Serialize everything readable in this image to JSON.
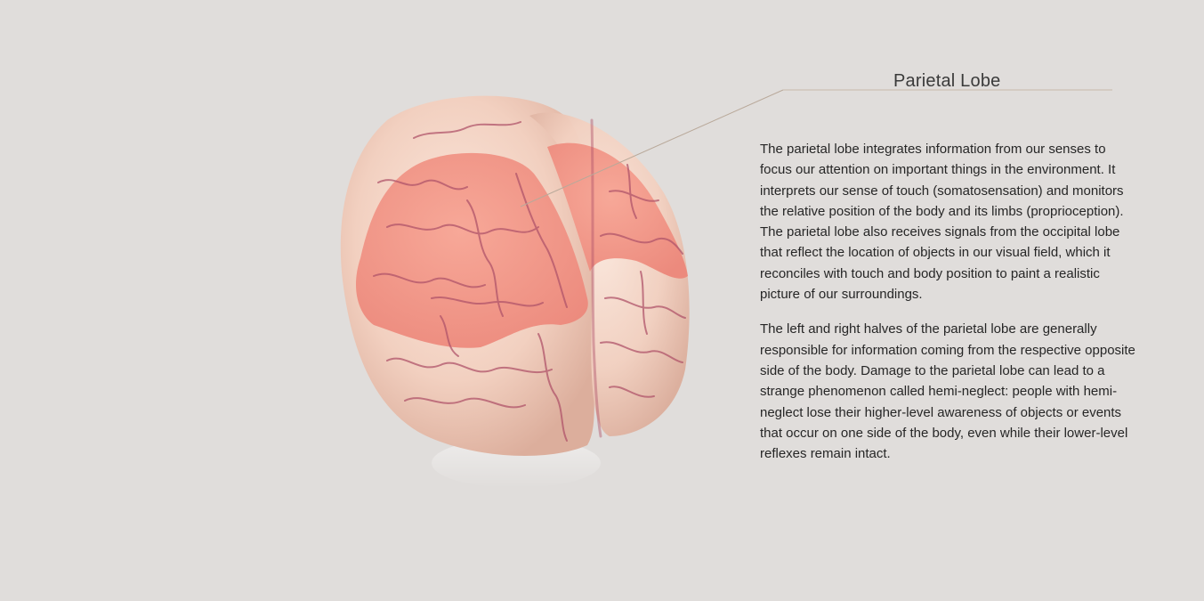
{
  "label": {
    "title": "Parietal Lobe"
  },
  "description": {
    "paragraphs": [
      "The parietal lobe integrates information from our senses to focus our attention on important things in the environment. It interprets our sense of touch (somatosensation) and monitors the relative position of the body and its limbs (proprioception). The parietal lobe also receives signals from the occipital lobe that reflect the location of objects in our visual field, which it reconciles with touch and body position to paint a realistic picture of our surroundings.",
      "The left and right halves of the parietal lobe are generally responsible for information coming from the respective opposite side of the body. Damage to the parietal lobe can lead to a strange phenomenon called hemi-neglect: people with hemi-neglect lose their higher-level awareness of objects or events that occur on one side of the body, even while their lower-level reflexes remain intact."
    ]
  },
  "colors": {
    "background": "#e0dddb",
    "brain_tissue": "#f2d2c2",
    "parietal_highlight": "#f29a8c",
    "sulcus": "#b0546a",
    "leader_line": "#b9a99a"
  },
  "icons": {
    "model": "brain-3d-model"
  }
}
